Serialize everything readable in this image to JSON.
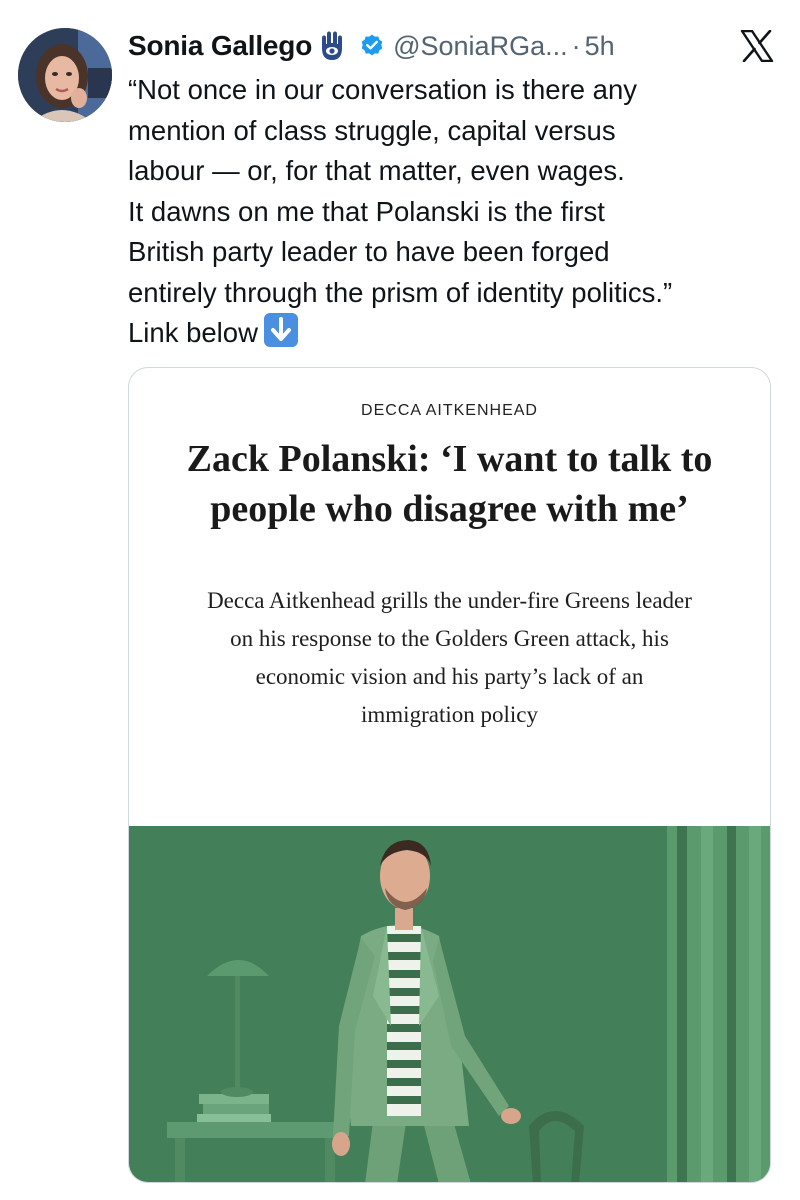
{
  "author": {
    "name": "Sonia Gallego",
    "handle": "@SoniaRGa...",
    "separator": "·",
    "timestamp": "5h",
    "badges": [
      "hamsa-emoji-icon",
      "verified-badge-icon"
    ]
  },
  "platform_icon": "x-logo-icon",
  "tweet_lines": [
    "“Not once in our conversation is there any",
    "mention of class struggle, capital versus",
    "labour — or, for that matter, even wages.",
    "It dawns on me that Polanski is the first",
    "British party leader to have been forged",
    "entirely through the prism of identity politics.”",
    "Link below"
  ],
  "link_emoji": "down-arrow-emoji-icon",
  "card": {
    "byline": "DECCA AITKENHEAD",
    "headline_lines": [
      "Zack Polanski: ‘I want to talk to",
      "people who disagree with me’"
    ],
    "standfirst_lines": [
      "Decca Aitkenhead grills the under-fire Greens leader",
      "on his response to the Golders Green attack, his",
      "economic vision and his party’s lack of an",
      "immigration policy"
    ]
  },
  "colors": {
    "text": "#0f1419",
    "secondary": "#536471",
    "verified": "#1d9bf0",
    "border": "#cfd9de",
    "photo_background": "#3f7a55"
  }
}
